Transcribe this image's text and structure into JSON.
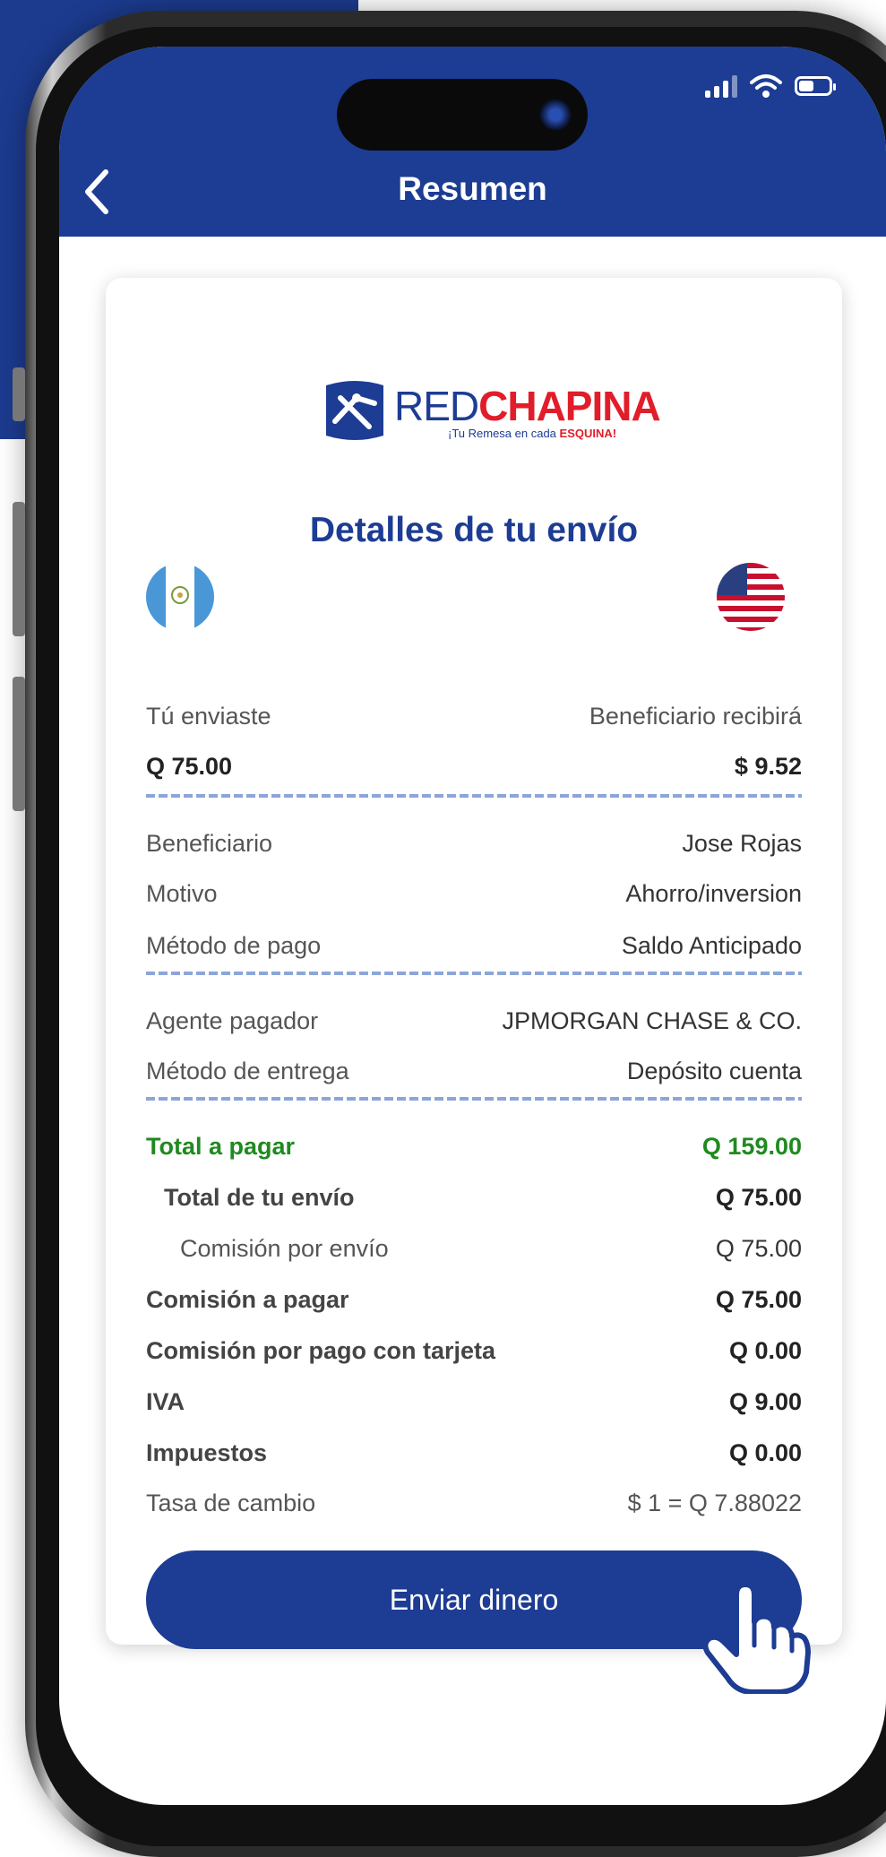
{
  "header": {
    "title": "Resumen"
  },
  "logo": {
    "red": "RED",
    "chapina": "CHAPINA",
    "tagline_pre": "¡Tu Remesa en cada ",
    "tagline_em": "ESQUINA!"
  },
  "heading": "Detalles de tu envío",
  "transfer": {
    "sent_label": "Tú enviaste",
    "received_label": "Beneficiario recibirá",
    "sent_value": "Q 75.00",
    "received_value": "$ 9.52"
  },
  "details": [
    {
      "label": "Beneficiario",
      "value": "Jose  Rojas"
    },
    {
      "label": "Motivo",
      "value": "Ahorro/inversion"
    },
    {
      "label": "Método de pago",
      "value": "Saldo Anticipado"
    }
  ],
  "agent": [
    {
      "label": "Agente pagador",
      "value": "JPMORGAN CHASE & CO."
    },
    {
      "label": "Método de entrega",
      "value": "Depósito cuenta"
    }
  ],
  "totals": {
    "total_pagar": {
      "label": "Total a pagar",
      "value": "Q 159.00"
    },
    "total_envio": {
      "label": "Total de tu envío",
      "value": "Q 75.00"
    },
    "comision_envio": {
      "label": "Comisión por envío",
      "value": "Q 75.00"
    },
    "comision_pagar": {
      "label": "Comisión a pagar",
      "value": "Q 75.00"
    },
    "comision_tarjeta": {
      "label": "Comisión por pago con tarjeta",
      "value": "Q 0.00"
    },
    "iva": {
      "label": "IVA",
      "value": "Q 9.00"
    },
    "impuestos": {
      "label": "Impuestos",
      "value": "Q 0.00"
    },
    "tasa": {
      "label": "Tasa de cambio",
      "value": "$ 1 = Q 7.88022"
    }
  },
  "button": {
    "label": "Enviar dinero"
  },
  "colors": {
    "brand_blue": "#1d3c93",
    "green": "#1f8a1f",
    "red": "#e11d2a"
  }
}
